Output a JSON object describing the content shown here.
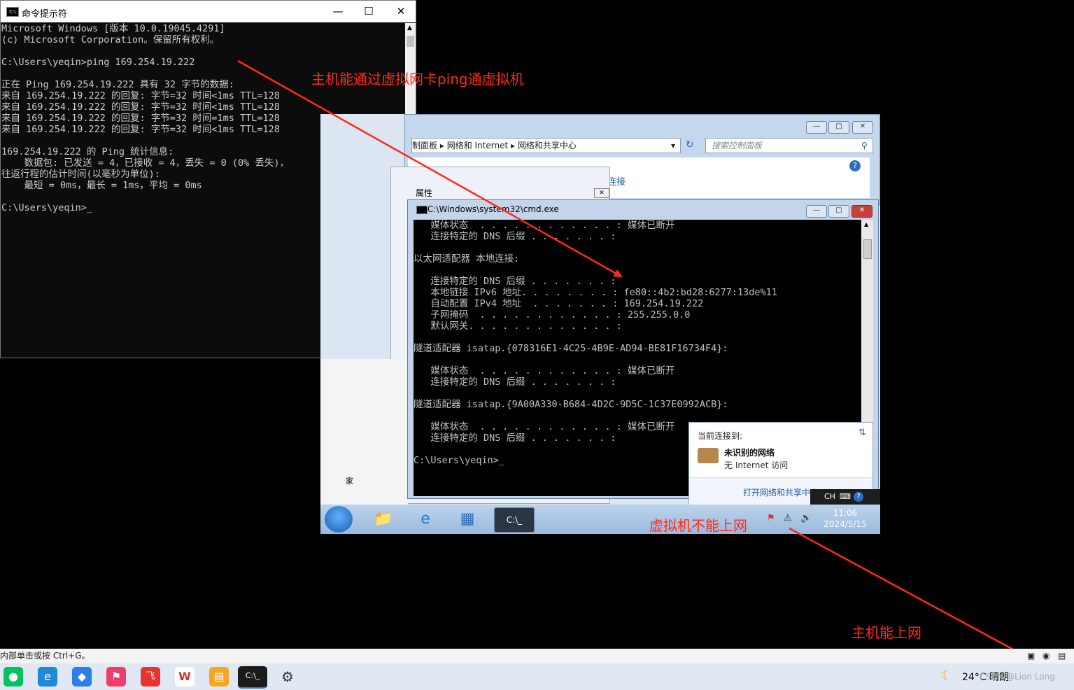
{
  "host_cmd": {
    "title": "命令提示符",
    "lines": [
      "Microsoft Windows [版本 10.0.19045.4291]",
      "(c) Microsoft Corporation。保留所有权利。",
      "",
      "C:\\Users\\yeqin>ping 169.254.19.222",
      "",
      "正在 Ping 169.254.19.222 具有 32 字节的数据:",
      "来自 169.254.19.222 的回复: 字节=32 时间<1ms TTL=128",
      "来自 169.254.19.222 的回复: 字节=32 时间<1ms TTL=128",
      "来自 169.254.19.222 的回复: 字节=32 时间=1ms TTL=128",
      "来自 169.254.19.222 的回复: 字节=32 时间<1ms TTL=128",
      "",
      "169.254.19.222 的 Ping 统计信息:",
      "    数据包: 已发送 = 4，已接收 = 4，丢失 = 0 (0% 丢失)，",
      "往返行程的估计时间(以毫秒为单位):",
      "    最短 = 0ms，最长 = 1ms，平均 = 0ms",
      "",
      "C:\\Users\\yeqin>_"
    ]
  },
  "vm": {
    "control_panel": {
      "breadcrumb": [
        "制面板",
        "网络和 Internet",
        "网络和共享中心"
      ],
      "search_placeholder": "搜索控制面板",
      "dialog_fragment": "连接",
      "dialog2_title": "属性",
      "left_fragment": "家"
    },
    "cmd": {
      "title": "C:\\Windows\\system32\\cmd.exe",
      "lines": [
        "   媒体状态  . . . . . . . . . . . . : 媒体已断开",
        "   连接特定的 DNS 后缀 . . . . . . . :",
        "",
        "以太网适配器 本地连接:",
        "",
        "   连接特定的 DNS 后缀 . . . . . . . :",
        "   本地链接 IPv6 地址. . . . . . . . : fe80::4b2:bd28:6277:13de%11",
        "   自动配置 IPv4 地址  . . . . . . . : 169.254.19.222",
        "   子网掩码  . . . . . . . . . . . . : 255.255.0.0",
        "   默认网关. . . . . . . . . . . . . :",
        "",
        "隧道适配器 isatap.{078316E1-4C25-4B9E-AD94-BE81F16734F4}:",
        "",
        "   媒体状态  . . . . . . . . . . . . : 媒体已断开",
        "   连接特定的 DNS 后缀 . . . . . . . :",
        "",
        "隧道适配器 isatap.{9A00A330-B684-4D2C-9D5C-1C37E0992ACB}:",
        "",
        "   媒体状态  . . . . . . . . . . . . : 媒体已断开",
        "   连接特定的 DNS 后缀 . . . . . . . :",
        "",
        "C:\\Users\\yeqin>_"
      ]
    },
    "network_popup": {
      "header": "当前连接到:",
      "network_name": "未识别的网络",
      "network_status": "无 Internet 访问",
      "link": "打开网络和共享中心"
    },
    "langbar": "CH",
    "clock": {
      "time": "11:06",
      "date": "2024/5/15"
    }
  },
  "annotations": {
    "ping_ok": "主机能通过虚拟网卡ping通虚拟机",
    "vm_no_net": "虚拟机不能上网",
    "host_net_ok": "主机能上网"
  },
  "host": {
    "status_text": "内部单击或按 Ctrl+G。",
    "weather": "24°C 晴朗",
    "watermark": "CSDN @Lion Long"
  },
  "colors": {
    "annotation": "#ff2a1a",
    "cmd_bg": "#0c0c0c",
    "vm_taskbar": "#9ab9db"
  }
}
